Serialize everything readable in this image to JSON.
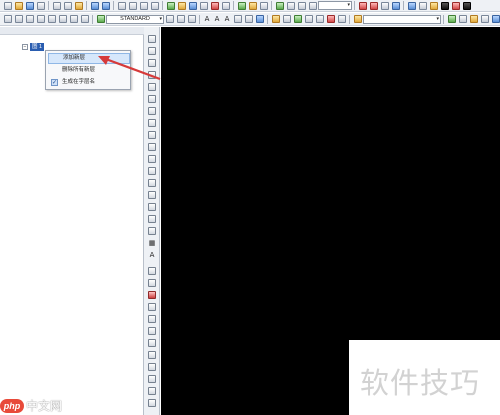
{
  "toolbar_top": {
    "row1_icons": [
      "new-icon",
      "open-icon",
      "save-icon",
      "plot-icon",
      "preview-icon",
      "publish-icon",
      "cut-icon",
      "copy-icon",
      "paste-icon",
      "match-icon",
      "undo-icon",
      "redo-icon",
      "pan-icon",
      "zoom-realtime-icon",
      "zoom-window-icon",
      "zoom-previous-icon",
      "properties-icon",
      "design-center-icon",
      "tool-palette-icon",
      "sheet-set-icon",
      "markup-icon",
      "calc-icon",
      "help-icon"
    ],
    "row2_text_style": "STANDARD",
    "row2_glyphs": [
      "A",
      "A",
      "A"
    ]
  },
  "tree": {
    "node_label": "图 1",
    "expander": "−"
  },
  "context_menu": {
    "items": [
      {
        "label": "添加新层"
      },
      {
        "label": "删除所有新层"
      },
      {
        "label": "生成在字层名",
        "checked": true
      }
    ],
    "check_mark": "✓"
  },
  "palette": {
    "glyph_text": "A",
    "glyph_table": "▦"
  },
  "colors": {
    "canvas": "#000000",
    "selection": "#2a5db0",
    "annotation_arrow": "#d63a3a"
  },
  "watermark": {
    "right_text": "软件技巧",
    "left_logo": "php",
    "left_text": "中文网"
  }
}
